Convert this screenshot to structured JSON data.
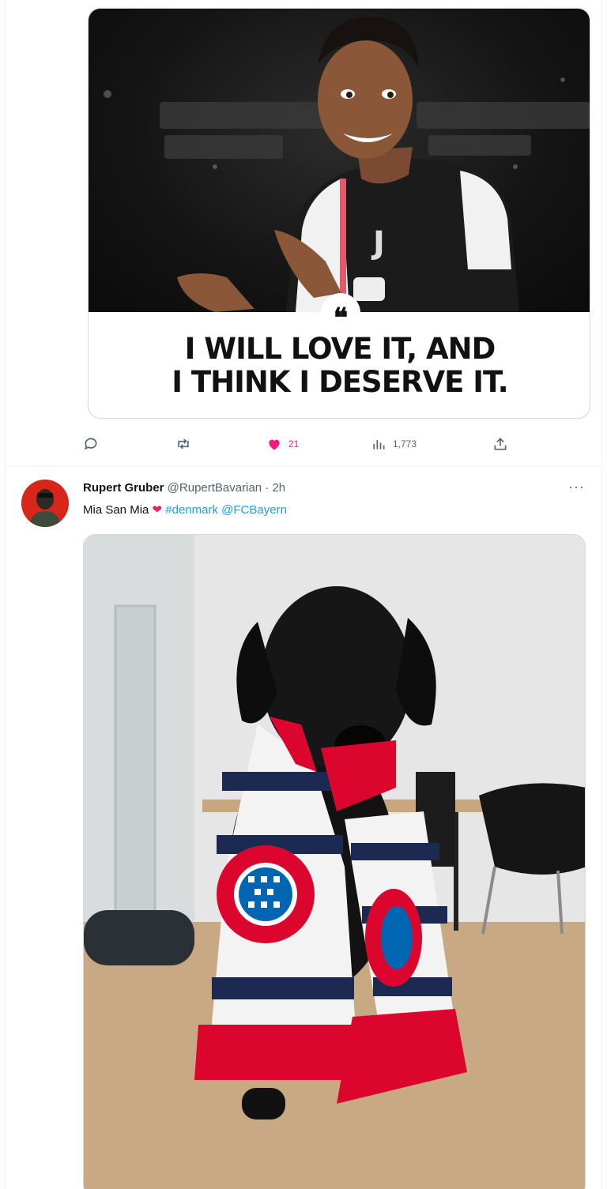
{
  "tweet1": {
    "quote_text": "I WILL LOVE IT, AND\nI THINK I DESERVE IT.",
    "quote_badge": "❝",
    "actions": {
      "reply_count": "",
      "retweet_count": "",
      "like_count": "21",
      "views_count": "1,773",
      "like_color": "#f91880"
    }
  },
  "tweet2": {
    "display_name": "Rupert Gruber",
    "meta": " @RupertBavarian · 2h",
    "text_start": "Mia San Mia ",
    "heart": "❤",
    "hashtag": "#denmark",
    "mention": "@FCBayern",
    "more": "···"
  },
  "icons": {
    "reply": "reply-icon",
    "retweet": "retweet-icon",
    "like": "heart-icon",
    "views": "views-icon",
    "share": "share-icon"
  },
  "colors": {
    "link": "#1d9bf0",
    "muted": "#536471",
    "border": "#cfd9de",
    "bayern_red": "#dc052d"
  }
}
